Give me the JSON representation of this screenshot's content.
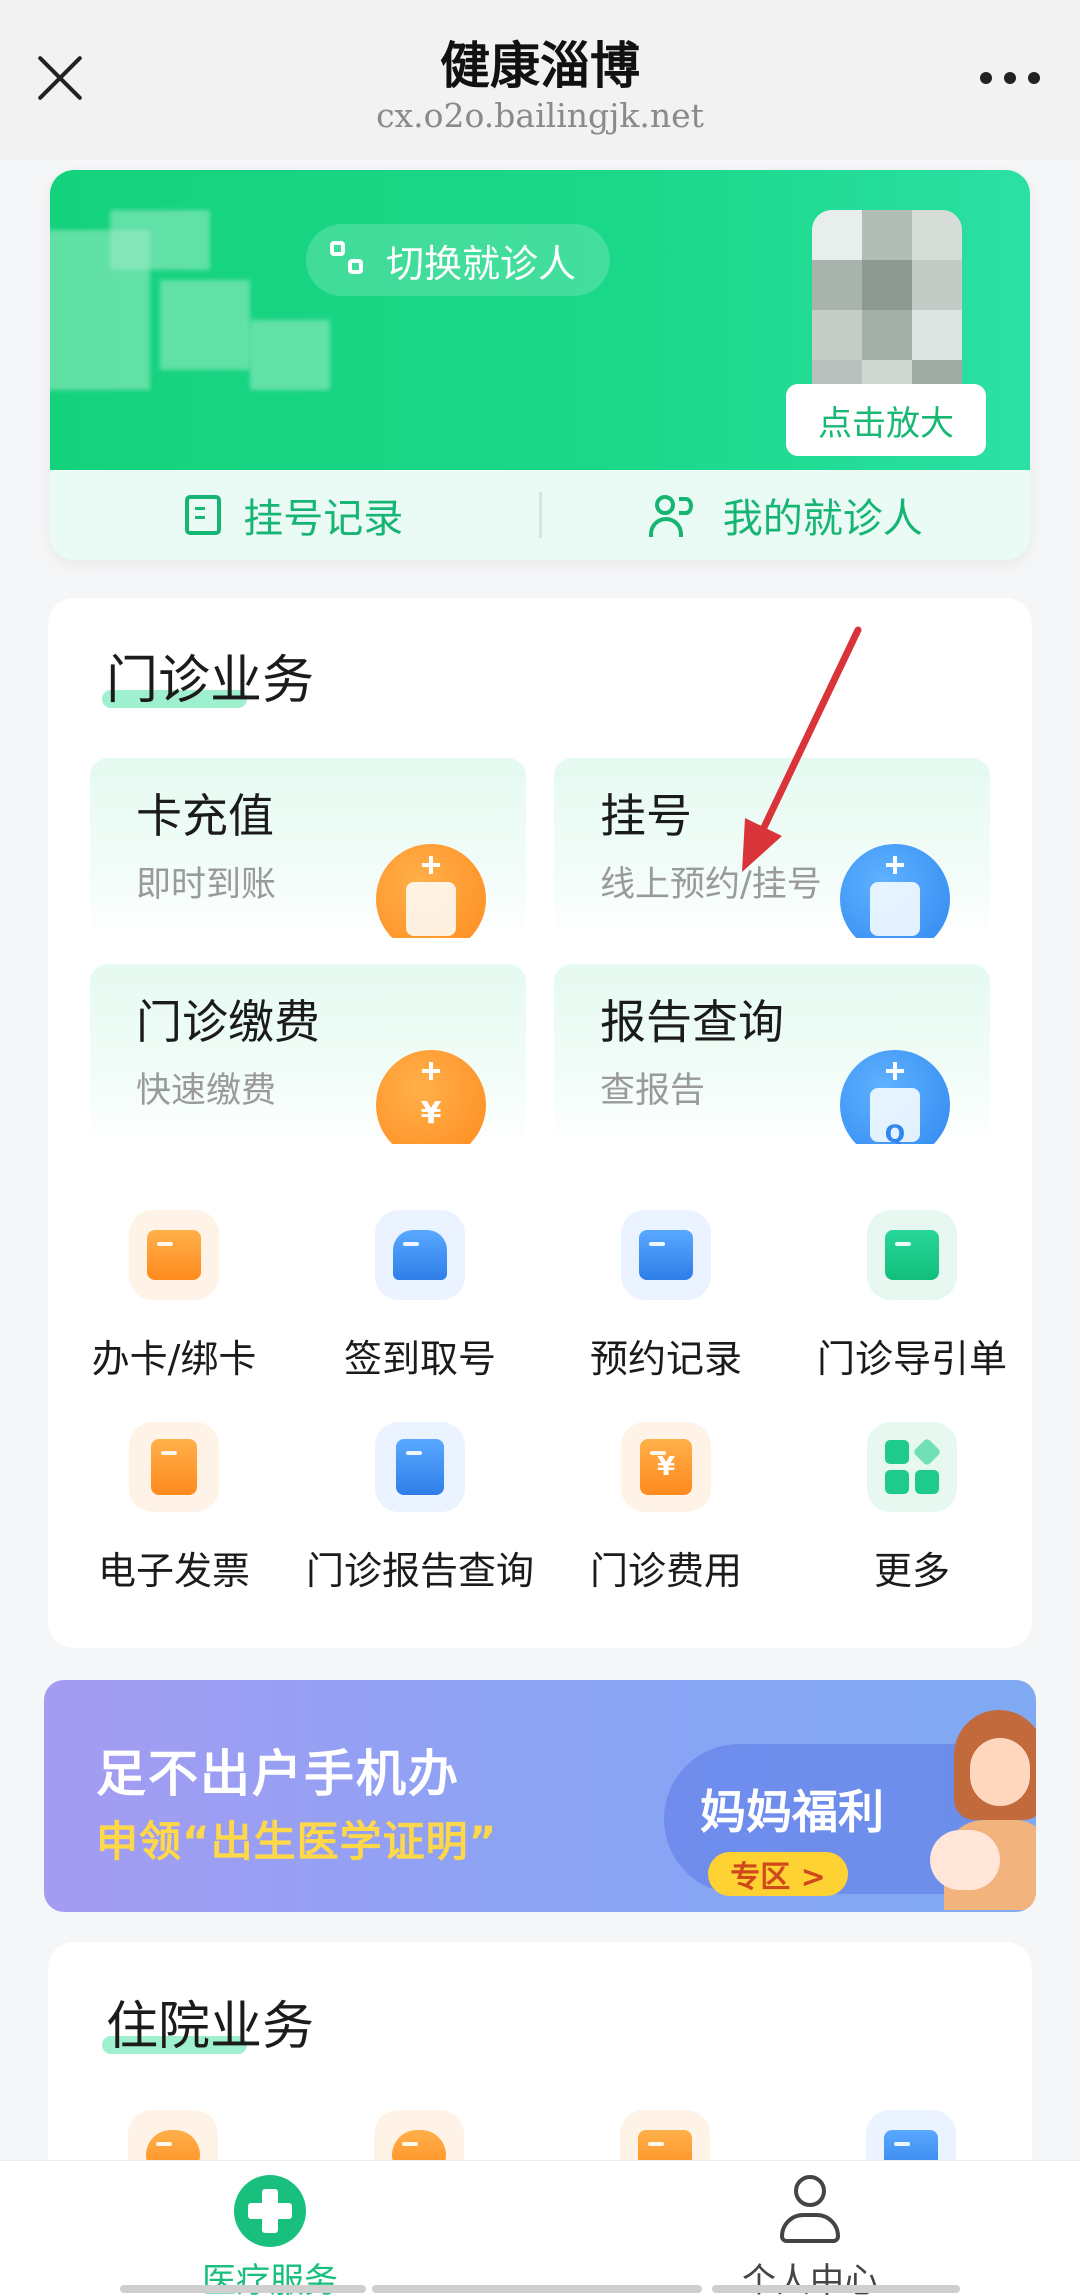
{
  "header": {
    "title": "健康淄博",
    "url": "cx.o2o.bailingjk.net"
  },
  "patient_card": {
    "switch_label": "切换就诊人",
    "zoom_label": "点击放大",
    "register_record": "挂号记录",
    "my_patients": "我的就诊人"
  },
  "outpatient": {
    "title": "门诊业务",
    "features": [
      {
        "title": "卡充值",
        "subtitle": "即时到账",
        "icon": "card-topup-icon"
      },
      {
        "title": "挂号",
        "subtitle": "线上预约/挂号",
        "icon": "register-icon"
      },
      {
        "title": "门诊缴费",
        "subtitle": "快速缴费",
        "icon": "payment-icon",
        "glyph": "¥"
      },
      {
        "title": "报告查询",
        "subtitle": "查报告",
        "icon": "report-icon",
        "glyph": "Q"
      }
    ],
    "grid": [
      {
        "label": "办卡/绑卡",
        "icon": "card-icon"
      },
      {
        "label": "签到取号",
        "icon": "checkin-icon"
      },
      {
        "label": "预约记录",
        "icon": "appointment-record-icon"
      },
      {
        "label": "门诊导引单",
        "icon": "guide-sheet-icon"
      },
      {
        "label": "电子发票",
        "icon": "invoice-icon"
      },
      {
        "label": "门诊报告查询",
        "icon": "report-query-icon"
      },
      {
        "label": "门诊费用",
        "icon": "fee-icon",
        "glyph": "¥"
      },
      {
        "label": "更多",
        "icon": "more-grid-icon"
      }
    ]
  },
  "banner": {
    "line1": "足不出户手机办",
    "line2": "申领“出生医学证明”",
    "badge": "妈妈福利",
    "zone": "专区 >"
  },
  "inpatient": {
    "title": "住院业务"
  },
  "tabbar": {
    "medical": "医疗服务",
    "personal": "个人中心"
  },
  "colors": {
    "brand_green": "#19c07d",
    "annotation_red": "#d9343a"
  }
}
